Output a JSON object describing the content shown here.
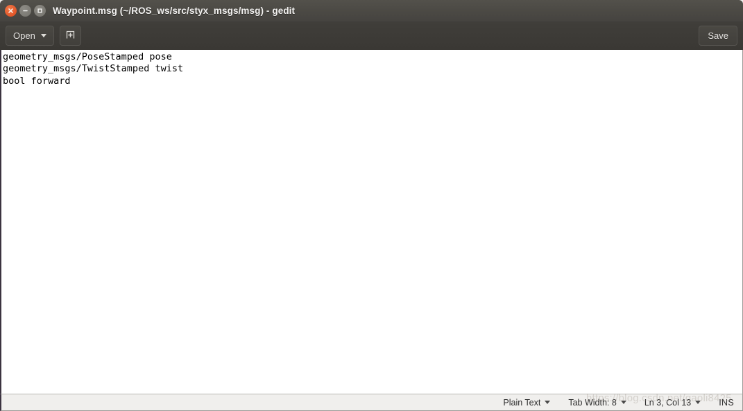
{
  "window": {
    "title": "Waypoint.msg (~/ROS_ws/src/styx_msgs/msg) - gedit",
    "controls": {
      "close_label": "Close",
      "minimize_label": "Minimize",
      "maximize_label": "Maximize"
    }
  },
  "toolbar": {
    "open_label": "Open",
    "new_tab_icon": "new-document-icon",
    "save_label": "Save"
  },
  "editor": {
    "content": "geometry_msgs/PoseStamped pose\ngeometry_msgs/TwistStamped twist\nbool forward"
  },
  "statusbar": {
    "language": "Plain Text",
    "tab_width": "Tab Width: 8",
    "position": "Ln 3, Col 13",
    "insert_mode": "INS"
  },
  "watermark": {
    "text": "https://blog.csdn.net/gaoli8425"
  },
  "colors": {
    "titlebar": "#4b4944",
    "toolbar": "#3c3a36",
    "close_button": "#e2572a",
    "editor_background": "#ffffff",
    "statusbar": "#f0efed"
  }
}
